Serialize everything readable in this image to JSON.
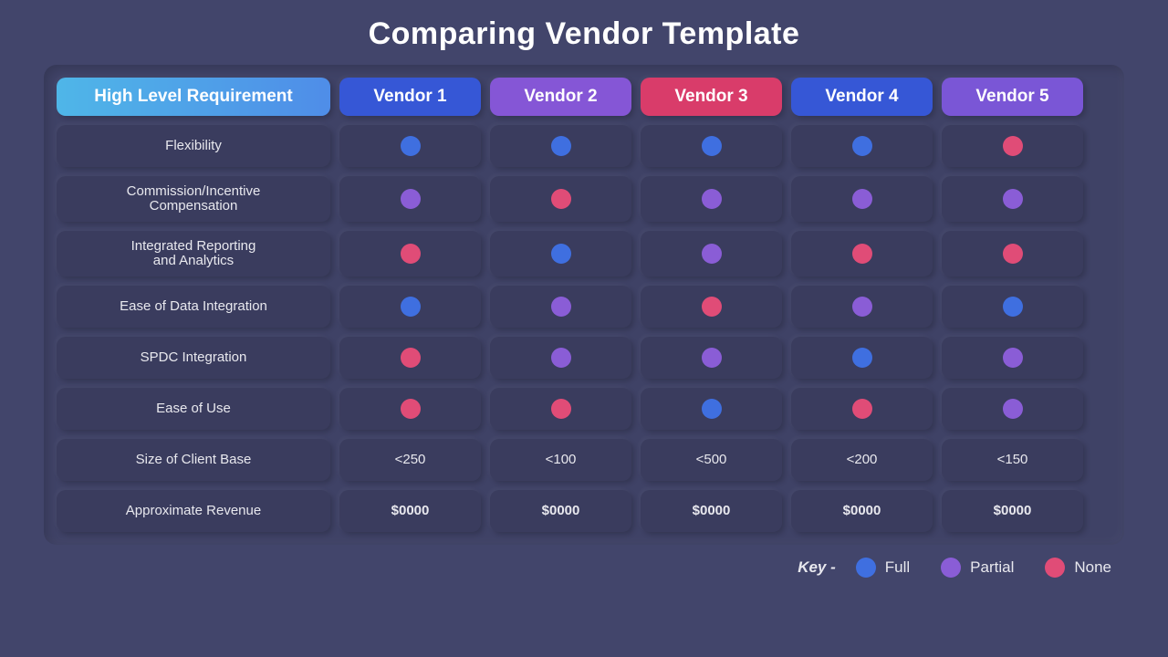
{
  "title": "Comparing Vendor Template",
  "colors": {
    "full": "#3f6fe0",
    "partial": "#8a5dd6",
    "none": "#e04c77",
    "req_header_bg": "linear-gradient(90deg,#4fb6e8,#4f8de8)",
    "vendor_bg": [
      "#3657d6",
      "#8556d6",
      "#d93c6a",
      "#3657d6",
      "#7a56d6"
    ]
  },
  "headers": {
    "requirement": "High Level Requirement",
    "vendors": [
      "Vendor 1",
      "Vendor 2",
      "Vendor 3",
      "Vendor 4",
      "Vendor 5"
    ]
  },
  "rows": [
    {
      "label": "Flexibility",
      "type": "dot",
      "values": [
        "full",
        "full",
        "full",
        "full",
        "none"
      ]
    },
    {
      "label": "Commission/Incentive\nCompensation",
      "type": "dot",
      "tall": true,
      "values": [
        "partial",
        "none",
        "partial",
        "partial",
        "partial"
      ]
    },
    {
      "label": "Integrated Reporting\nand Analytics",
      "type": "dot",
      "tall": true,
      "values": [
        "none",
        "full",
        "partial",
        "none",
        "none"
      ]
    },
    {
      "label": "Ease of Data Integration",
      "type": "dot",
      "values": [
        "full",
        "partial",
        "none",
        "partial",
        "full"
      ]
    },
    {
      "label": "SPDC Integration",
      "type": "dot",
      "values": [
        "none",
        "partial",
        "partial",
        "full",
        "partial"
      ]
    },
    {
      "label": "Ease of Use",
      "type": "dot",
      "values": [
        "none",
        "none",
        "full",
        "none",
        "partial"
      ]
    },
    {
      "label": "Size of Client Base",
      "type": "text",
      "values": [
        "<250",
        "<100",
        "<500",
        "<200",
        "<150"
      ]
    },
    {
      "label": "Approximate Revenue",
      "type": "text",
      "bold": true,
      "values": [
        "$0000",
        "$0000",
        "$0000",
        "$0000",
        "$0000"
      ]
    }
  ],
  "legend": {
    "prefix": "Key -",
    "items": [
      {
        "key": "full",
        "label": "Full"
      },
      {
        "key": "partial",
        "label": "Partial"
      },
      {
        "key": "none",
        "label": "None"
      }
    ]
  }
}
